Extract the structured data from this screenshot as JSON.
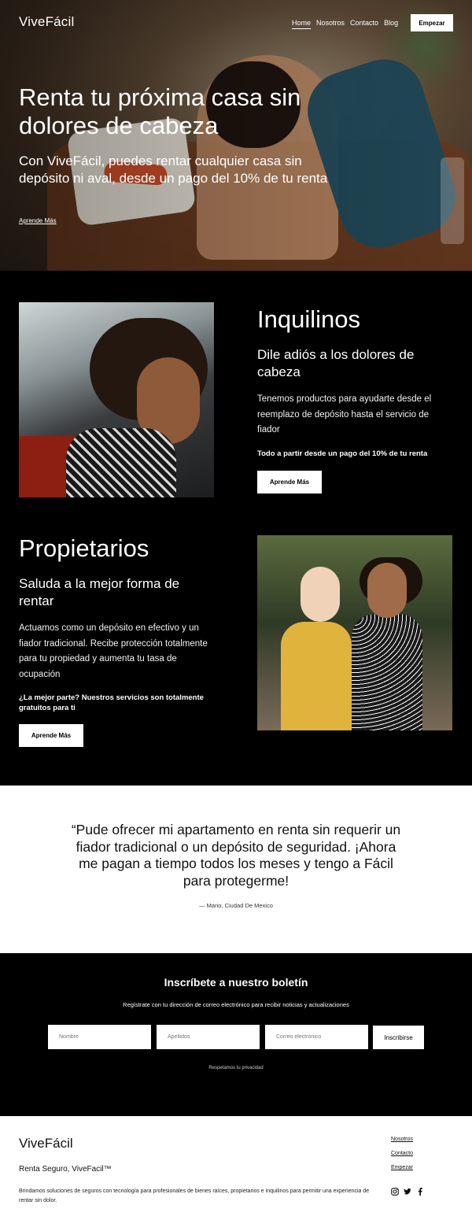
{
  "brand": "ViveFácil",
  "nav": {
    "links": [
      "Home",
      "Nosotros",
      "Contacto",
      "Blog"
    ],
    "cta": "Empezar"
  },
  "hero": {
    "title": "Renta tu próxima casa sin dolores de cabeza",
    "subtitle": "Con ViveFácil, puedes rentar cualquier casa sin depósito ni aval, desde un pago del 10% de tu renta",
    "link": "Aprende Más"
  },
  "inquilinos": {
    "title": "Inquilinos",
    "subtitle": "Dile adiós a los dolores de cabeza",
    "body": "Tenemos productos para ayudarte desde el reemplazo de depósito hasta el servicio de fiador",
    "highlight": "Todo a partir desde un pago del 10% de tu renta",
    "button": "Aprende Más"
  },
  "propietarios": {
    "title": "Propietarios",
    "subtitle": "Saluda a la mejor forma de rentar",
    "body": "Actuamos como un depósito en efectivo y un fiador tradicional. Recibe protección totalmente para tu propiedad y aumenta tu tasa de ocupación",
    "highlight": "¿La mejor parte? Nuestros servicios son totalmente gratuitos para ti",
    "button": "Aprende Más"
  },
  "testimonial": {
    "quote": "“Pude ofrecer mi apartamento en renta sin requerir un fiador tradicional o un depósito de seguridad. ¡Ahora me pagan a tiempo todos los meses y tengo a Fácil para protegerme!",
    "author": "— Mario, Ciudad De Mexico"
  },
  "newsletter": {
    "title": "Inscríbete a nuestro boletín",
    "subtitle": "Regístrate con tu dirección de correo electrónico para recibir noticias y actualizaciones",
    "fields": {
      "nombre": "Nombre",
      "apellidos": "Apellidos",
      "email": "Correo electrónico"
    },
    "button": "Inscribirse",
    "privacy": "Respetamos tu privacidad"
  },
  "footer": {
    "logo": "ViveFácil",
    "tagline": "Renta Seguro, ViveFacil™",
    "description": "Brindamos soluciones de seguros con tecnología para profesionales de bienes raíces, propietarios e inquilinos para permitir una experiencia de rentar sin dolor.",
    "links": [
      "Nosotros",
      "Contacto",
      "Empezar"
    ],
    "social": [
      "instagram-icon",
      "twitter-icon",
      "facebook-icon"
    ]
  }
}
